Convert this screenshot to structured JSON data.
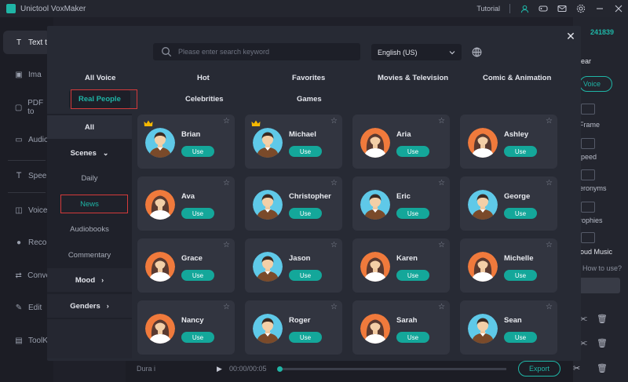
{
  "app": {
    "title": "Unictool VoxMaker",
    "tutorial": "Tutorial",
    "credits": "241839",
    "accent": "#1fb5a6"
  },
  "sidebar": {
    "items": [
      {
        "label": "Text t",
        "icon": "text-icon"
      },
      {
        "label": "Ima",
        "icon": "image-icon"
      },
      {
        "label": "PDF to",
        "icon": "pdf-icon"
      },
      {
        "label": "Audio",
        "icon": "audio-icon"
      },
      {
        "label": "Spee",
        "icon": "speech-icon"
      },
      {
        "label": "Voice",
        "icon": "voice-icon"
      },
      {
        "label": "Recor",
        "icon": "mic-icon"
      },
      {
        "label": "Conve",
        "icon": "convert-icon"
      },
      {
        "label": "Edit",
        "icon": "edit-icon"
      },
      {
        "label": "ToolK",
        "icon": "toolkit-icon"
      }
    ]
  },
  "right_panel": {
    "ear": "ear",
    "voice": "Voice",
    "items": [
      "Frame",
      "peed",
      "eronyms",
      "rophies",
      "roud Music"
    ],
    "how_to": "How to use?"
  },
  "bottom": {
    "duration": "Dura i",
    "time": "00:00/00:05",
    "export": "Export"
  },
  "modal": {
    "search_placeholder": "Please enter search keyword",
    "language": "English (US)",
    "categories_row1": [
      "All Voice",
      "Hot",
      "Favorites",
      "Movies & Television",
      "Comic & Animation"
    ],
    "categories_row2": [
      "Real People",
      "Celebrities",
      "Games"
    ],
    "filters": [
      {
        "label": "All"
      },
      {
        "label": "Scenes",
        "chev": "⌄"
      },
      {
        "label": "Daily"
      },
      {
        "label": "News"
      },
      {
        "label": "Audiobooks"
      },
      {
        "label": "Commentary"
      },
      {
        "label": "Mood",
        "chev": "›"
      },
      {
        "label": "Genders",
        "chev": "›"
      }
    ],
    "use_label": "Use",
    "voices": [
      {
        "name": "Brian",
        "gender": "male",
        "crown": true
      },
      {
        "name": "Michael",
        "gender": "male",
        "crown": true
      },
      {
        "name": "Aria",
        "gender": "female",
        "crown": false
      },
      {
        "name": "Ashley",
        "gender": "female",
        "crown": false
      },
      {
        "name": "Ava",
        "gender": "female",
        "crown": false
      },
      {
        "name": "Christopher",
        "gender": "male",
        "crown": false
      },
      {
        "name": "Eric",
        "gender": "male",
        "crown": false
      },
      {
        "name": "George",
        "gender": "male",
        "crown": false
      },
      {
        "name": "Grace",
        "gender": "female",
        "crown": false
      },
      {
        "name": "Jason",
        "gender": "male",
        "crown": false
      },
      {
        "name": "Karen",
        "gender": "female",
        "crown": false
      },
      {
        "name": "Michelle",
        "gender": "female",
        "crown": false
      },
      {
        "name": "Nancy",
        "gender": "female",
        "crown": false
      },
      {
        "name": "Roger",
        "gender": "male",
        "crown": false
      },
      {
        "name": "Sarah",
        "gender": "female",
        "crown": false
      },
      {
        "name": "Sean",
        "gender": "male",
        "crown": false
      }
    ]
  }
}
